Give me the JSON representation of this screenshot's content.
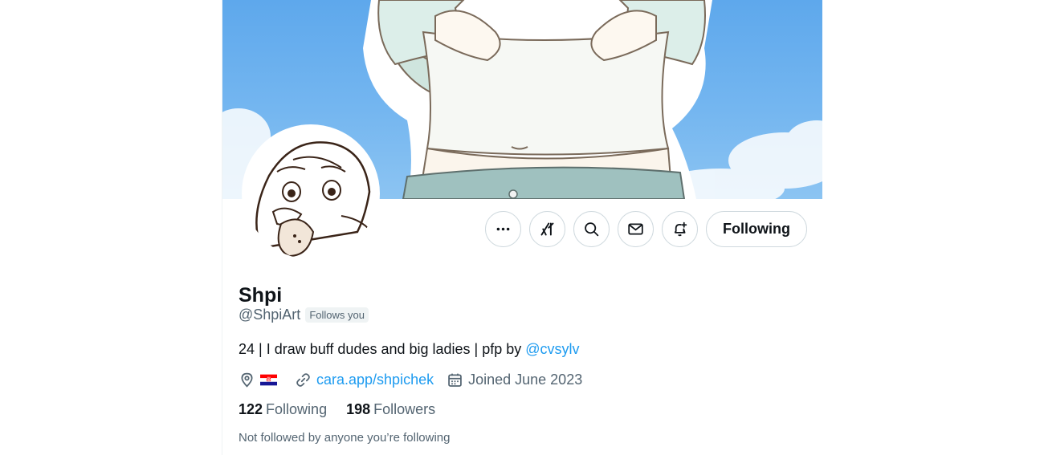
{
  "profile": {
    "display_name": "Shpi",
    "handle": "@ShpiArt",
    "follows_you_badge": "Follows you",
    "bio_text": "24 | I draw buff dudes and big ladies | pfp by ",
    "bio_mention": "@cvsylv",
    "location_icon": "location-pin-icon",
    "location_flag": "croatia-flag",
    "website": "cara.app/shpichek",
    "joined": "Joined June 2023",
    "following_count": "122",
    "following_label": "Following",
    "followers_count": "198",
    "followers_label": "Followers",
    "mutuals_note": "Not followed by anyone you’re following"
  },
  "actions": {
    "more_icon": "more-icon",
    "grok_icon": "grok-icon",
    "search_icon": "search-icon",
    "message_icon": "mail-icon",
    "notify_icon": "bell-plus-icon",
    "follow_label": "Following"
  },
  "colors": {
    "accent": "#1d9bf0",
    "secondary_text": "#536471",
    "banner_sky": "#6cb1ee"
  }
}
